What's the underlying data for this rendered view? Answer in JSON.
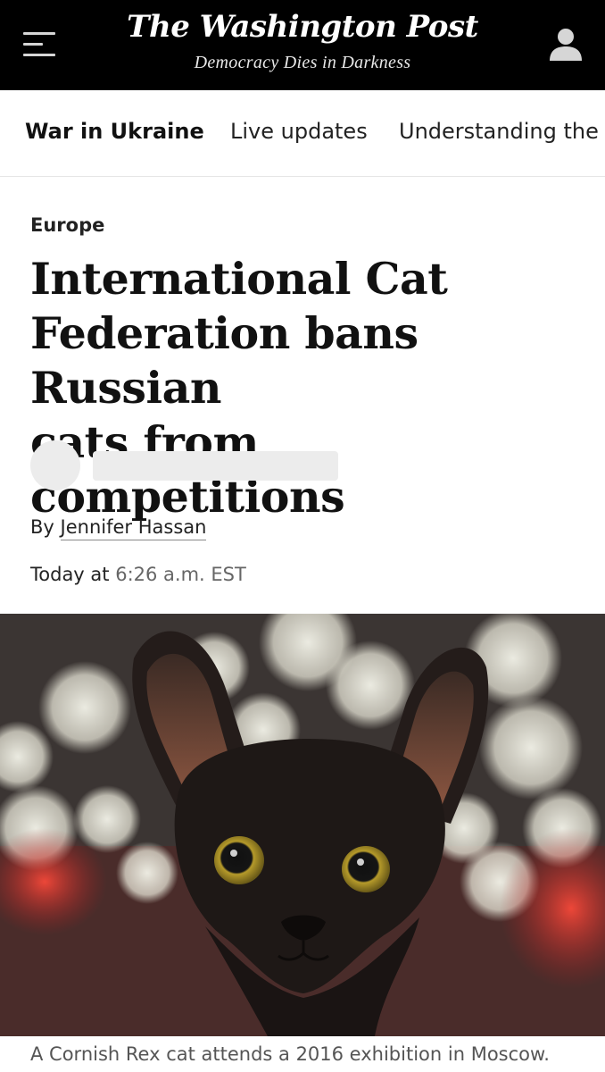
{
  "masthead": {
    "logo": "The Washington Post",
    "tagline": "Democracy Dies in Darkness",
    "menu_icon": "hamburger-menu-icon",
    "user_icon": "user-account-icon",
    "background": "#000000"
  },
  "subnav": {
    "items": [
      {
        "label": "War in Ukraine"
      },
      {
        "label": "Live updates"
      },
      {
        "label": "Understanding the c"
      }
    ]
  },
  "article": {
    "kicker": "Europe",
    "headline_lines": [
      "International Cat",
      "Federation bans Russian",
      "cats from competitions"
    ],
    "byline_prefix": "By",
    "author": "Jennifer Hassan",
    "date_prefix": "Today at",
    "time": "6:26 a.m. EST",
    "photo_caption": "A Cornish Rex cat attends a 2016 exhibition in Moscow."
  }
}
